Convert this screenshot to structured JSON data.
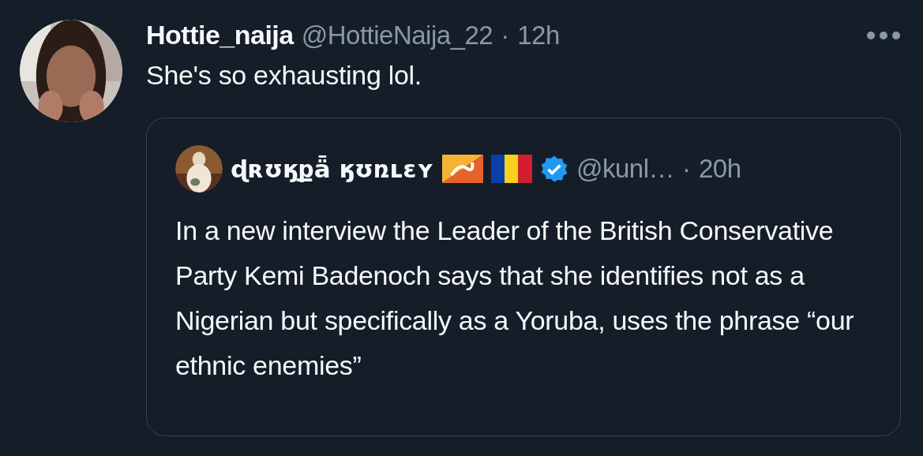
{
  "tweet": {
    "name": "Hottie_naija",
    "handle": "@HottieNaija_22",
    "separator": "·",
    "time": "12h",
    "text": "She's so exhausting lol.",
    "quote": {
      "name": "ɖʀʊӄքǟ ӄʊռʟɛʏ",
      "verified": true,
      "handle": "@kunl…",
      "separator": "·",
      "time": "20h",
      "text": "In a new interview the Leader of the British Conservative Party Kemi Badenoch says that she identifies not as a Nigerian but specifically as a Yoruba, uses the phrase “our ethnic enemies”"
    }
  }
}
